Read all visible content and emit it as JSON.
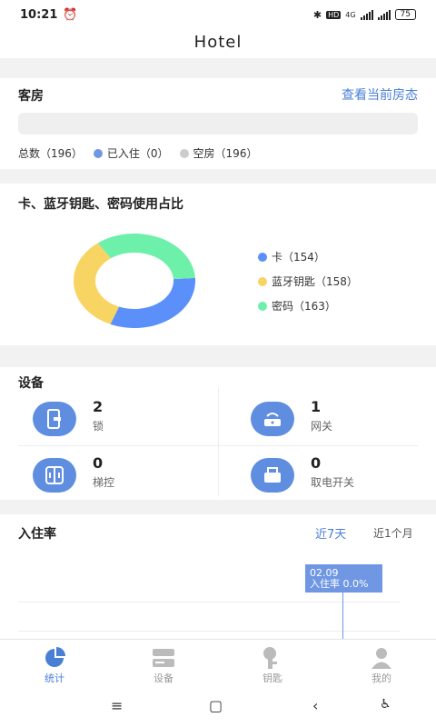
{
  "status_bar": {
    "time": "10:21",
    "network": "4G",
    "hd": "HD",
    "battery": "75"
  },
  "app_title": "Hotel",
  "rooms": {
    "title": "客房",
    "view_link": "查看当前房态",
    "total": "总数（196）",
    "occupied": "已入住（0）",
    "vacant": "空房（196）",
    "colors": {
      "occupied": "#6f97e3",
      "vacant": "#cccccc"
    }
  },
  "usage": {
    "title": "卡、蓝牙钥匙、密码使用占比",
    "legend": [
      {
        "label": "卡（154）",
        "color": "#5b8ff9"
      },
      {
        "label": "蓝牙钥匙（158）",
        "color": "#f8d462"
      },
      {
        "label": "密码（163）",
        "color": "#6df0aa"
      }
    ]
  },
  "chart_data": {
    "type": "pie",
    "donut": true,
    "categories": [
      "卡",
      "蓝牙钥匙",
      "密码"
    ],
    "values": [
      154,
      158,
      163
    ],
    "colors": [
      "#5b8ff9",
      "#f8d462",
      "#6df0aa"
    ]
  },
  "devices": {
    "title": "设备",
    "items": [
      {
        "count": "2",
        "label": "锁",
        "icon": "lock-icon"
      },
      {
        "count": "1",
        "label": "网关",
        "icon": "gateway-icon"
      },
      {
        "count": "0",
        "label": "梯控",
        "icon": "elevator-control-icon"
      },
      {
        "count": "0",
        "label": "取电开关",
        "icon": "power-switch-icon"
      }
    ]
  },
  "occupancy": {
    "title": "入住率",
    "tab_7d": "近7天",
    "tab_1m": "近1个月",
    "tooltip_date": "02.09",
    "tooltip_value": "入住率 0.0%"
  },
  "tabbar": [
    {
      "label": "统计",
      "icon": "stats-pie-icon",
      "active": true
    },
    {
      "label": "设备",
      "icon": "device-icon",
      "active": false
    },
    {
      "label": "钥匙",
      "icon": "key-icon",
      "active": false
    },
    {
      "label": "我的",
      "icon": "profile-icon",
      "active": false
    }
  ],
  "system_nav": {
    "menu": "≡",
    "home": "▢",
    "back": "‹"
  }
}
